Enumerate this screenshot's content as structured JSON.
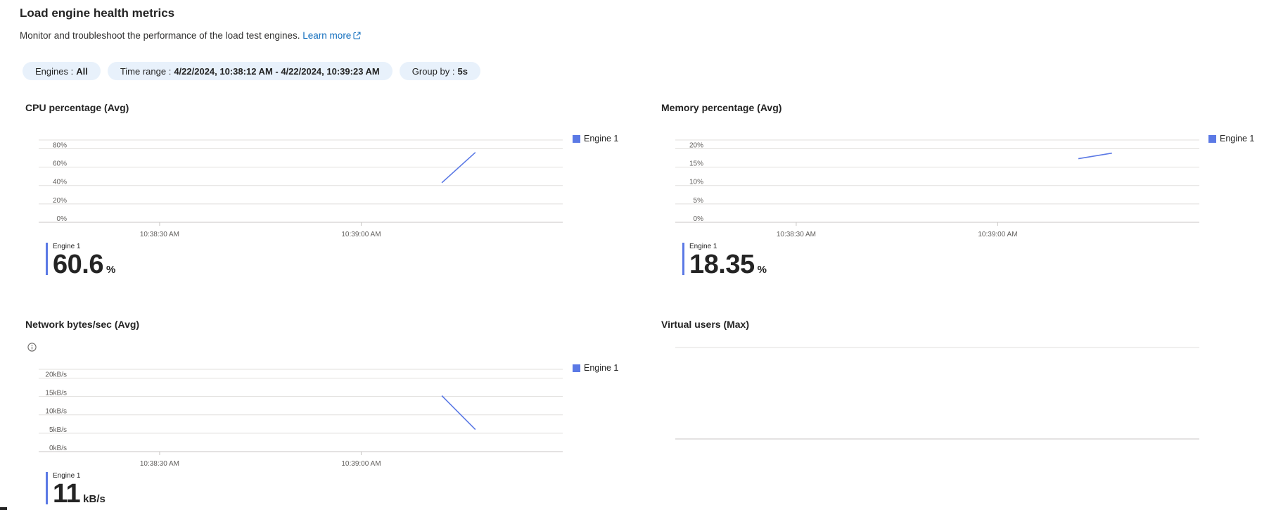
{
  "page": {
    "title": "Load engine health metrics",
    "description": "Monitor and troubleshoot the performance of the load test engines.",
    "learn_more": "Learn more"
  },
  "filters": [
    {
      "label": "Engines :",
      "value": "All"
    },
    {
      "label": "Time range :",
      "value": "4/22/2024, 10:38:12 AM - 4/22/2024, 10:39:23 AM"
    },
    {
      "label": "Group by :",
      "value": "5s"
    }
  ],
  "colors": {
    "series": "#5b79e5",
    "link": "#0f6cbd",
    "pill": "#e8f1fb"
  },
  "icons": {
    "external_link": "external-link-icon",
    "info": "info-icon"
  },
  "charts": {
    "cpu": {
      "title": "CPU percentage (Avg)",
      "legend": "Engine 1",
      "summary": {
        "name": "Engine 1",
        "value": "60.6",
        "unit": "%"
      }
    },
    "memory": {
      "title": "Memory percentage (Avg)",
      "legend": "Engine 1",
      "summary": {
        "name": "Engine 1",
        "value": "18.35",
        "unit": "%"
      }
    },
    "network": {
      "title": "Network bytes/sec (Avg)",
      "legend": "Engine 1",
      "summary": {
        "name": "Engine 1",
        "value": "11",
        "unit": "kB/s"
      }
    },
    "vusers": {
      "title": "Virtual users (Max)"
    }
  },
  "chart_data": [
    {
      "type": "line",
      "title": "CPU percentage (Avg)",
      "x_ticks": [
        "10:38:30 AM",
        "10:39:00 AM"
      ],
      "x_range": [
        "10:38:12 AM",
        "10:39:30 AM"
      ],
      "y_ticks": [
        "0%",
        "20%",
        "40%",
        "60%",
        "80%"
      ],
      "ylim": [
        0,
        88
      ],
      "grid": true,
      "legend_position": "right",
      "series": [
        {
          "name": "Engine 1",
          "points": [
            [
              "10:39:12 AM",
              43
            ],
            [
              "10:39:17 AM",
              76
            ]
          ]
        }
      ]
    },
    {
      "type": "line",
      "title": "Memory percentage (Avg)",
      "x_ticks": [
        "10:38:30 AM",
        "10:39:00 AM"
      ],
      "x_range": [
        "10:38:12 AM",
        "10:39:30 AM"
      ],
      "y_ticks": [
        "0%",
        "5%",
        "10%",
        "15%",
        "20%"
      ],
      "ylim": [
        0,
        22
      ],
      "grid": true,
      "legend_position": "right",
      "series": [
        {
          "name": "Engine 1",
          "points": [
            [
              "10:39:12 AM",
              17.3
            ],
            [
              "10:39:17 AM",
              18.8
            ]
          ]
        }
      ]
    },
    {
      "type": "line",
      "title": "Network bytes/sec (Avg)",
      "x_ticks": [
        "10:38:30 AM",
        "10:39:00 AM"
      ],
      "x_range": [
        "10:38:12 AM",
        "10:39:30 AM"
      ],
      "y_ticks": [
        "0kB/s",
        "5kB/s",
        "10kB/s",
        "15kB/s",
        "20kB/s"
      ],
      "ylim": [
        0,
        22
      ],
      "grid": true,
      "legend_position": "right",
      "series": [
        {
          "name": "Engine 1",
          "points": [
            [
              "10:39:12 AM",
              15.2
            ],
            [
              "10:39:17 AM",
              6.0
            ]
          ]
        }
      ]
    },
    {
      "type": "line",
      "title": "Virtual users (Max)",
      "grid": true,
      "series": []
    }
  ]
}
